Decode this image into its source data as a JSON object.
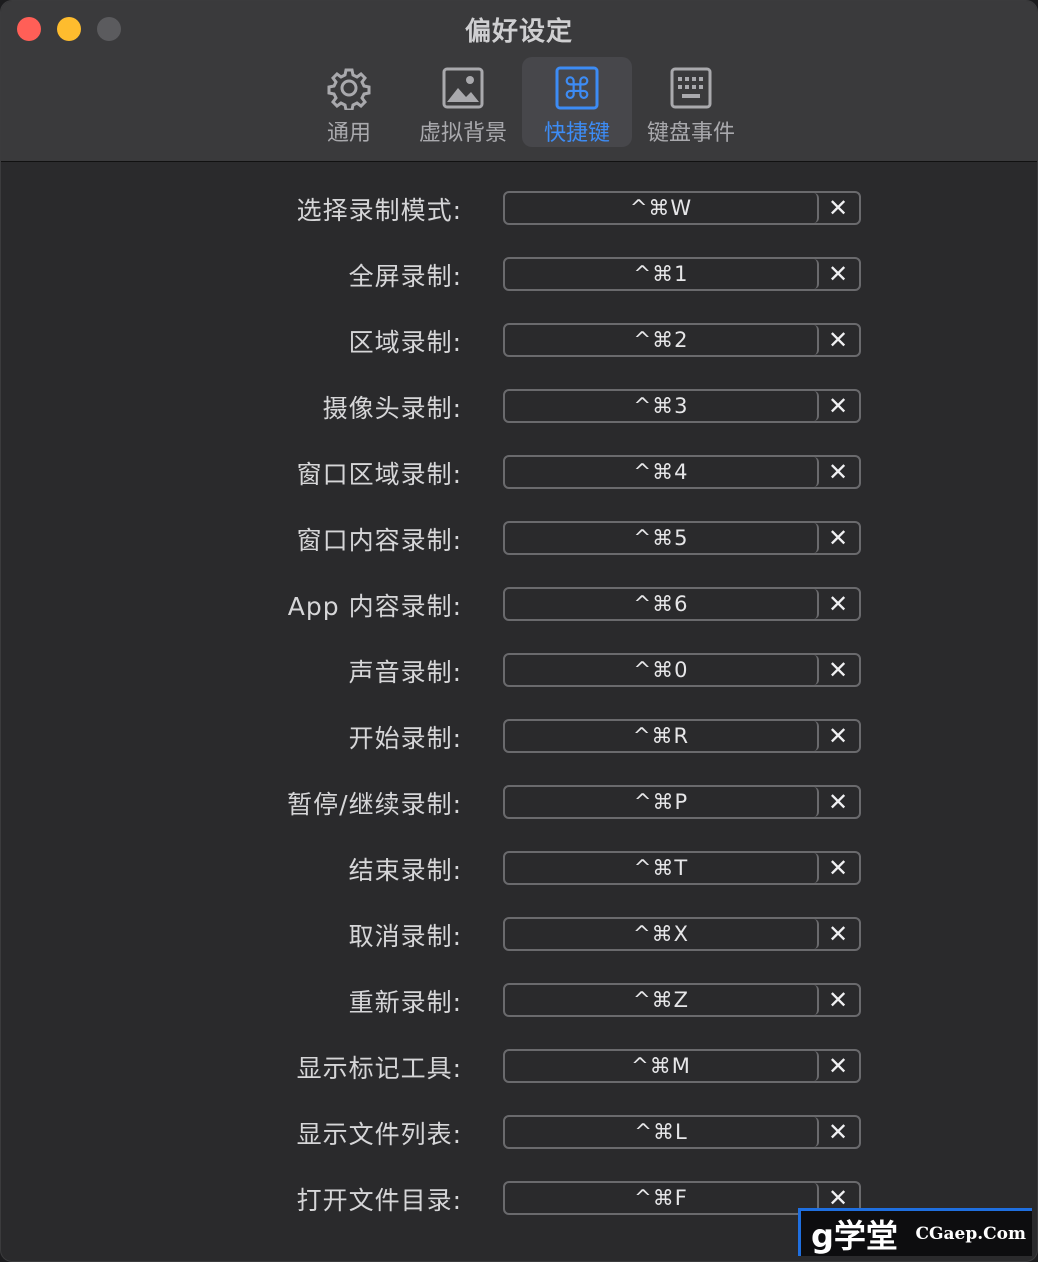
{
  "window": {
    "title": "偏好设定"
  },
  "tabs": [
    {
      "label": "通用",
      "icon": "gear-icon"
    },
    {
      "label": "虚拟背景",
      "icon": "image-icon"
    },
    {
      "label": "快捷键",
      "icon": "command-icon",
      "active": true
    },
    {
      "label": "键盘事件",
      "icon": "keyboard-icon"
    }
  ],
  "shortcuts": [
    {
      "label": "选择录制模式:",
      "keys": "^⌘W"
    },
    {
      "label": "全屏录制:",
      "keys": "^⌘1"
    },
    {
      "label": "区域录制:",
      "keys": "^⌘2"
    },
    {
      "label": "摄像头录制:",
      "keys": "^⌘3"
    },
    {
      "label": "窗口区域录制:",
      "keys": "^⌘4"
    },
    {
      "label": "窗口内容录制:",
      "keys": "^⌘5"
    },
    {
      "label": "App 内容录制:",
      "keys": "^⌘6"
    },
    {
      "label": "声音录制:",
      "keys": "^⌘0"
    },
    {
      "label": "开始录制:",
      "keys": "^⌘R"
    },
    {
      "label": "暂停/继续录制:",
      "keys": "^⌘P"
    },
    {
      "label": "结束录制:",
      "keys": "^⌘T"
    },
    {
      "label": "取消录制:",
      "keys": "^⌘X"
    },
    {
      "label": "重新录制:",
      "keys": "^⌘Z"
    },
    {
      "label": "显示标记工具:",
      "keys": "^⌘M"
    },
    {
      "label": "显示文件列表:",
      "keys": "^⌘L"
    },
    {
      "label": "打开文件目录:",
      "keys": "^⌘F"
    }
  ],
  "clear_symbol": "✕",
  "watermark": {
    "logo": "g学堂",
    "site": "CGaep.Com"
  },
  "colors": {
    "accent": "#3d8cf5",
    "close": "#ff5f57",
    "minimize": "#febc2e"
  }
}
